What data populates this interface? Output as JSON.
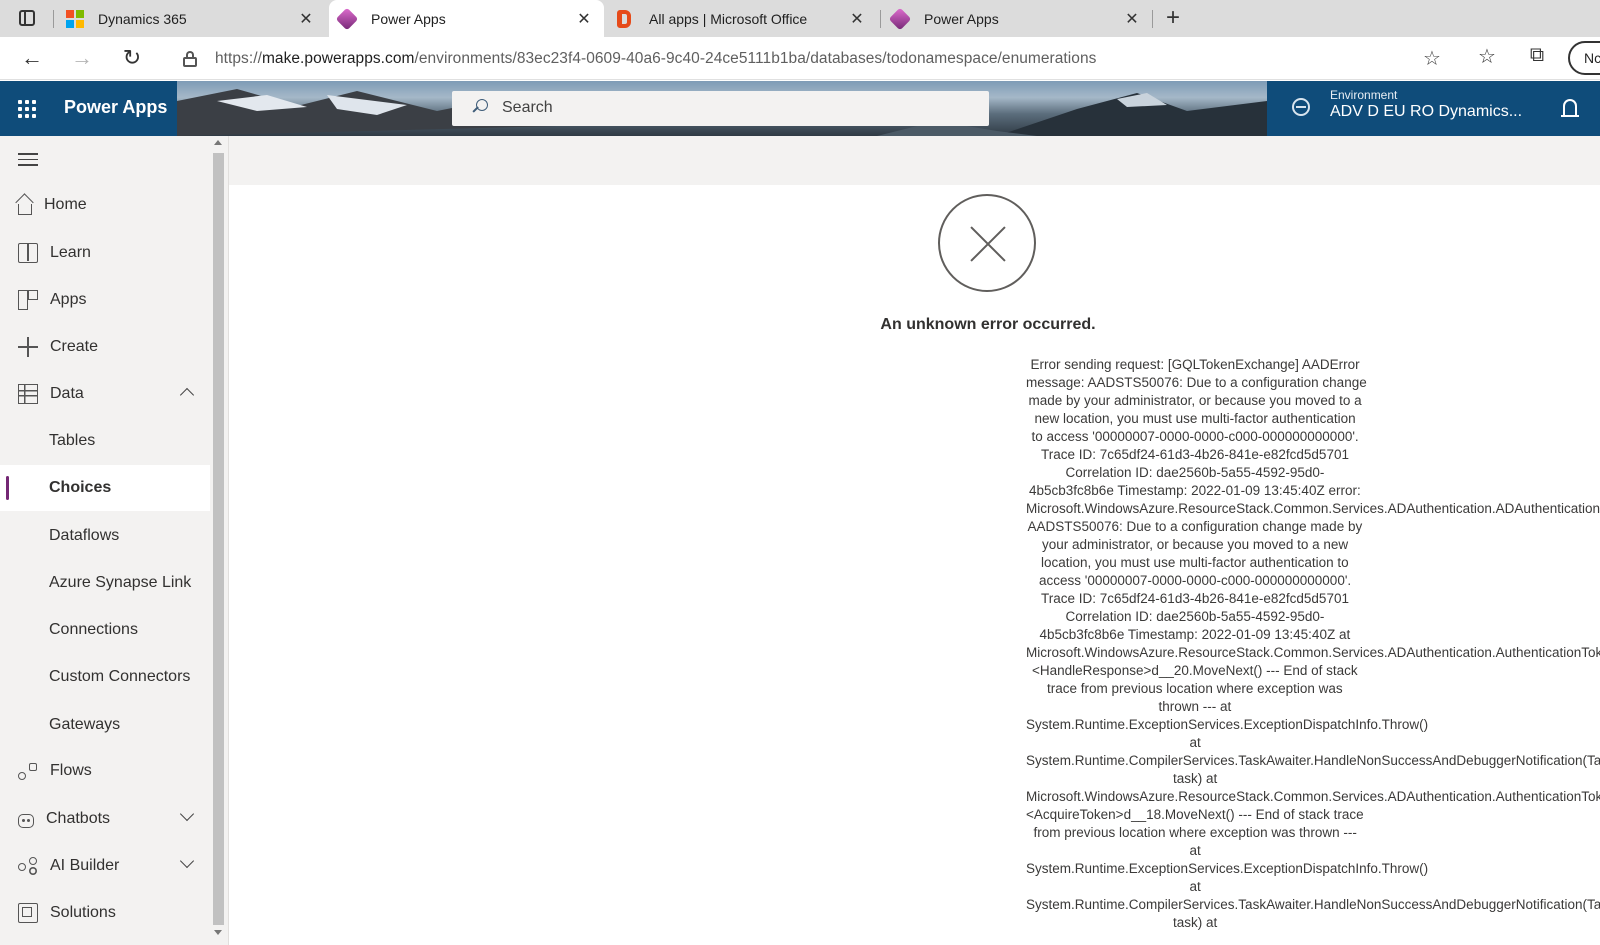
{
  "browser": {
    "tabs": [
      {
        "title": "Dynamics 365",
        "icon": "microsoft-logo-icon",
        "active": false
      },
      {
        "title": "Power Apps",
        "icon": "power-apps-icon",
        "active": true
      },
      {
        "title": "All apps | Microsoft Office",
        "icon": "office-icon",
        "active": false
      },
      {
        "title": "Power Apps",
        "icon": "power-apps-icon",
        "active": false
      }
    ],
    "close_glyph": "✕",
    "new_tab_glyph": "+",
    "url_scheme": "https://",
    "url_host": "make.powerapps.com",
    "url_path": "/environments/83ec23f4-0609-40a6-9c40-24ce5111b1ba/databases/todonamespace/enumerations",
    "profile_label": "Nc"
  },
  "header": {
    "app_name": "Power Apps",
    "search_placeholder": "Search",
    "environment_label": "Environment",
    "environment_value": "ADV D EU RO Dynamics...",
    "accent_color": "#742774"
  },
  "sidebar": {
    "items": [
      {
        "label": "Home",
        "icon": "home-icon"
      },
      {
        "label": "Learn",
        "icon": "book-icon"
      },
      {
        "label": "Apps",
        "icon": "apps-icon"
      },
      {
        "label": "Create",
        "icon": "plus-icon"
      },
      {
        "label": "Data",
        "icon": "table-icon",
        "expanded": true
      },
      {
        "label": "Tables"
      },
      {
        "label": "Choices",
        "selected": true
      },
      {
        "label": "Dataflows"
      },
      {
        "label": "Azure Synapse Link"
      },
      {
        "label": "Connections"
      },
      {
        "label": "Custom Connectors"
      },
      {
        "label": "Gateways"
      },
      {
        "label": "Flows",
        "icon": "flow-icon"
      },
      {
        "label": "Chatbots",
        "icon": "chatbot-icon",
        "expanded": false
      },
      {
        "label": "AI Builder",
        "icon": "ai-builder-icon",
        "expanded": false
      },
      {
        "label": "Solutions",
        "icon": "solutions-icon"
      }
    ]
  },
  "error": {
    "title": "An unknown error occurred.",
    "lines": [
      "Error sending request: [GQLTokenExchange] AADError",
      "message: AADSTS50076: Due to a configuration change",
      "made by your administrator, or because you moved to a",
      "new location, you must use multi-factor authentication",
      "to access '00000007-0000-0000-c000-000000000000'.",
      "Trace ID: 7c65df24-61d3-4b26-841e-e82fcd5d5701",
      "Correlation ID: dae2560b-5a55-4592-95d0-",
      "4b5cb3fc8b6e Timestamp: 2022-01-09 13:45:40Z error:",
      "Microsoft.WindowsAzure.ResourceStack.Common.Services.ADAuthentication.ADAuthenticationException:",
      "AADSTS50076: Due to a configuration change made by",
      "your administrator, or because you moved to a new",
      "location, you must use multi-factor authentication to",
      "access '00000007-0000-0000-c000-000000000000'.",
      "Trace ID: 7c65df24-61d3-4b26-841e-e82fcd5d5701",
      "Correlation ID: dae2560b-5a55-4592-95d0-",
      "4b5cb3fc8b6e Timestamp: 2022-01-09 13:45:40Z at",
      "Microsoft.WindowsAzure.ResourceStack.Common.Services.ADAuthentication.AuthenticationTokenProvider.",
      "<HandleResponse>d__20.MoveNext() --- End of stack",
      "trace from previous location where exception was",
      "thrown --- at",
      "System.Runtime.ExceptionServices.ExceptionDispatchInfo.Throw()",
      "at",
      "System.Runtime.CompilerServices.TaskAwaiter.HandleNonSuccessAndDebuggerNotification(Task",
      "task) at",
      "Microsoft.WindowsAzure.ResourceStack.Common.Services.ADAuthentication.AuthenticationTokenProvider.",
      "<AcquireToken>d__18.MoveNext() --- End of stack trace",
      "from previous location where exception was thrown ---",
      "at",
      "System.Runtime.ExceptionServices.ExceptionDispatchInfo.Throw()",
      "at",
      "System.Runtime.CompilerServices.TaskAwaiter.HandleNonSuccessAndDebuggerNotification(Task",
      "task) at"
    ]
  }
}
